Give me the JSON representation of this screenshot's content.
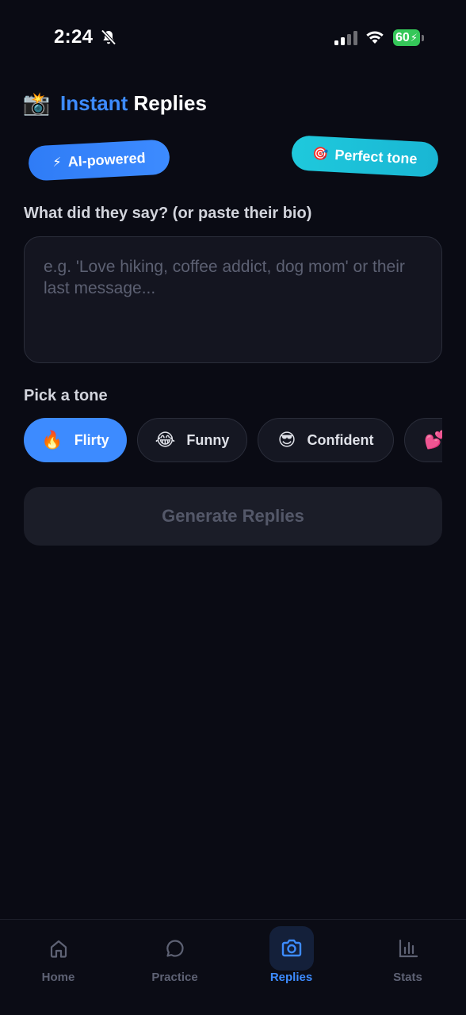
{
  "status_bar": {
    "time": "2:24",
    "battery": "60"
  },
  "header": {
    "emoji": "📸",
    "title_accent": "Instant",
    "title_rest": "Replies"
  },
  "badges": {
    "ai": {
      "icon": "⚡",
      "label": "AI-powered"
    },
    "tone": {
      "icon": "🎯",
      "label": "Perfect tone"
    }
  },
  "input": {
    "label": "What did they say? (or paste their bio)",
    "placeholder": "e.g. 'Love hiking, coffee addict, dog mom' or their last message..."
  },
  "tone": {
    "label": "Pick a tone",
    "options": [
      {
        "emoji": "🔥",
        "label": "Flirty",
        "selected": true
      },
      {
        "emoji": "😂",
        "label": "Funny",
        "selected": false
      },
      {
        "emoji": "😎",
        "label": "Confident",
        "selected": false
      },
      {
        "emoji": "💕",
        "label": "",
        "selected": false
      }
    ]
  },
  "generate_button": "Generate Replies",
  "nav": {
    "items": [
      {
        "label": "Home",
        "icon": "home-icon",
        "active": false
      },
      {
        "label": "Practice",
        "icon": "chat-bubble-icon",
        "active": false
      },
      {
        "label": "Replies",
        "icon": "camera-icon",
        "active": true
      },
      {
        "label": "Stats",
        "icon": "bar-chart-icon",
        "active": false
      }
    ]
  },
  "colors": {
    "background": "#0a0b14",
    "accent": "#3d8bff",
    "cyan": "#1fc9dc",
    "battery": "#35c759"
  }
}
